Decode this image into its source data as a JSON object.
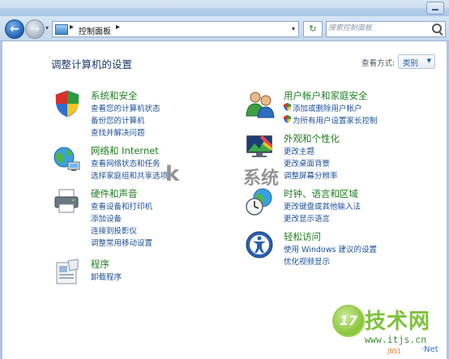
{
  "window": {
    "minimize_label": ""
  },
  "nav": {
    "back_arrow": "←",
    "forward_arrow": "→",
    "dropdown_arrow": "▾",
    "breadcrumb_separator": "▸",
    "breadcrumb": "控制面板",
    "breadcrumb_after": "▸",
    "address_dropdown": "▾",
    "refresh_glyph": "↻",
    "search_placeholder": "搜索控制面板"
  },
  "page": {
    "heading": "调整计算机的设置",
    "view_by_label": "查看方式:",
    "view_by_value": "类别",
    "view_by_arrow": "▼"
  },
  "categories_left": [
    {
      "title": "系统和安全",
      "icon": "shield-icon",
      "links": [
        "查看您的计算机状态",
        "备份您的计算机",
        "查找并解决问题"
      ]
    },
    {
      "title": "网络和 Internet",
      "icon": "network-icon",
      "links": [
        "查看网络状态和任务",
        "选择家庭组和共享选项"
      ]
    },
    {
      "title": "硬件和声音",
      "icon": "printer-icon",
      "links": [
        "查看设备和打印机",
        "添加设备",
        "连接到投影仪",
        "调整常用移动设置"
      ]
    },
    {
      "title": "程序",
      "icon": "programs-icon",
      "links": [
        "卸载程序"
      ]
    }
  ],
  "categories_right": [
    {
      "title": "用户帐户和家庭安全",
      "icon": "users-icon",
      "links": [
        "添加或删除用户帐户",
        "为所有用户设置家长控制"
      ]
    },
    {
      "title": "外观和个性化",
      "icon": "appearance-icon",
      "links": [
        "更改主题",
        "更改桌面背景",
        "调整屏幕分辨率"
      ]
    },
    {
      "title": "时钟、语言和区域",
      "icon": "clock-globe-icon",
      "links": [
        "更改键盘或其他输入法",
        "更改显示语言"
      ]
    },
    {
      "title": "轻松访问",
      "icon": "ease-of-access-icon",
      "links": [
        "使用 Windows 建议的设置",
        "优化视频显示"
      ]
    }
  ],
  "watermark": {
    "badge": "17",
    "brand": "技术网",
    "url": "www.itjs.cn",
    "mid_glyph_1": "k",
    "mid_glyph_2": "系统",
    "foot": "JB51",
    "foot2": "·Net"
  },
  "colors": {
    "title_green": "#1e7d1e",
    "link_blue": "#1b4f9a",
    "heading_navy": "#1a3a6a",
    "brand_green": "#7dc13a"
  }
}
